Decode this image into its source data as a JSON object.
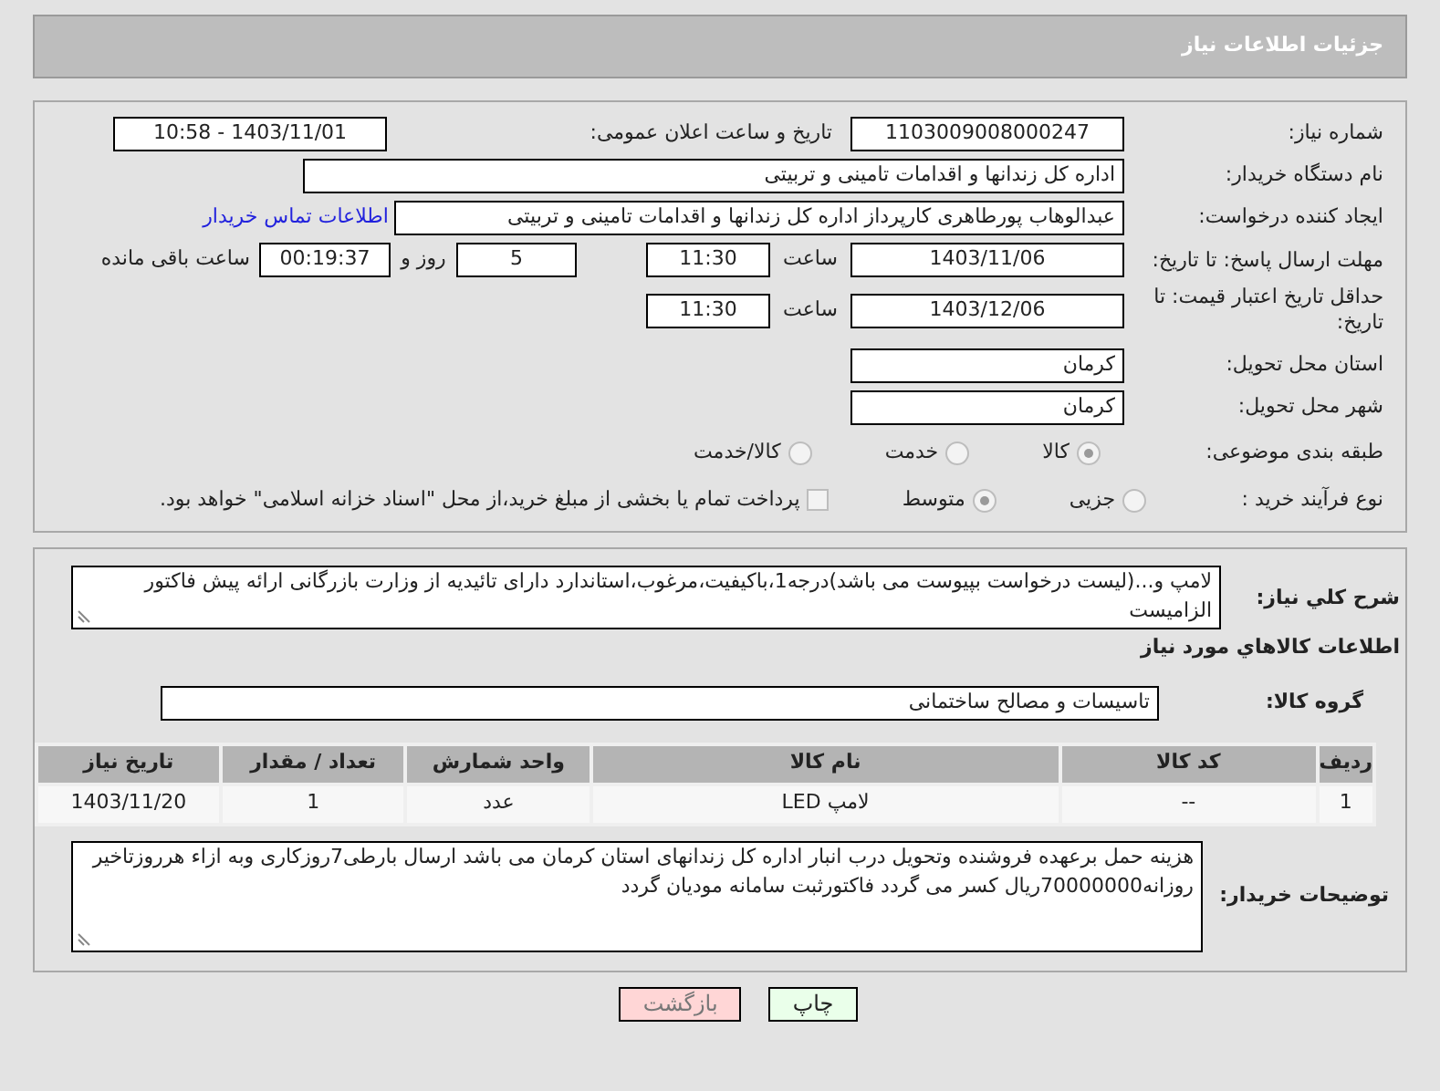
{
  "header": {
    "title": "جزئیات اطلاعات نیاز"
  },
  "need_number": {
    "label": "شماره نیاز:",
    "value": "1103009008000247"
  },
  "announce": {
    "label": "تاریخ و ساعت اعلان عمومی:",
    "value": "1403/11/01 - 10:58"
  },
  "buyer_org": {
    "label": "نام دستگاه خریدار:",
    "value": "اداره کل زندانها و اقدامات تامینی و تربیتی"
  },
  "creator": {
    "label": "ایجاد کننده درخواست:",
    "value": "عبدالوهاب پورطاهری کارپرداز اداره کل زندانها و اقدامات تامینی و تربیتی",
    "link": "اطلاعات تماس خریدار"
  },
  "response_deadline": {
    "label": "مهلت ارسال پاسخ: تا تاریخ:",
    "date": "1403/11/06",
    "time_label": "ساعت",
    "time": "11:30",
    "days": "5",
    "days_label": "روز و",
    "remaining": "00:19:37",
    "remaining_label": "ساعت باقی مانده"
  },
  "price_validity": {
    "label": "حداقل تاریخ اعتبار قیمت: تا تاریخ:",
    "date": "1403/12/06",
    "time_label": "ساعت",
    "time": "11:30"
  },
  "province": {
    "label": "استان محل تحویل:",
    "value": "کرمان"
  },
  "city": {
    "label": "شهر محل تحویل:",
    "value": "کرمان"
  },
  "category": {
    "label": "طبقه بندی موضوعی:",
    "options": [
      {
        "label": "کالا",
        "selected": true
      },
      {
        "label": "خدمت",
        "selected": false
      },
      {
        "label": "کالا/خدمت",
        "selected": false
      }
    ]
  },
  "purchase_type": {
    "label": "نوع فرآیند خرید :",
    "options": [
      {
        "label": "جزیی",
        "selected": false
      },
      {
        "label": "متوسط",
        "selected": true
      }
    ],
    "checkbox": {
      "checked": false,
      "text": "پرداخت تمام یا بخشی از مبلغ خرید،از محل \"اسناد خزانه اسلامی\" خواهد بود."
    }
  },
  "description": {
    "label": "شرح كلي نياز:",
    "value": "لامپ و...(لیست درخواست بپیوست می باشد)درجه1،باکیفیت،مرغوب،استاندارد دارای تائیدیه از وزارت بازرگانی ارائه پیش فاکتور الزامیست"
  },
  "goods_title": "اطلاعات كالاهاي مورد نياز",
  "goods_group": {
    "label": "گروه کالا:",
    "value": "تاسیسات و مصالح ساختمانی"
  },
  "table": {
    "columns": [
      "ردیف",
      "کد کالا",
      "نام کالا",
      "واحد شمارش",
      "تعداد / مقدار",
      "تاریخ نیاز"
    ],
    "rows": [
      [
        "1",
        "--",
        "لامپ LED",
        "عدد",
        "1",
        "1403/11/20"
      ]
    ]
  },
  "buyer_notes": {
    "label": "توضیحات خریدار:",
    "value": "هزینه حمل برعهده فروشنده وتحویل درب انبار اداره کل زندانهای استان کرمان می باشد ارسال بارطی7روزکاری وبه ازاء هرروزتاخیر روزانه70000000ریال کسر می گردد فاکتورثبت سامانه مودیان گردد"
  },
  "buttons": [
    {
      "label": "چاپ",
      "kind": "print"
    },
    {
      "label": "بازگشت",
      "kind": "back"
    }
  ]
}
